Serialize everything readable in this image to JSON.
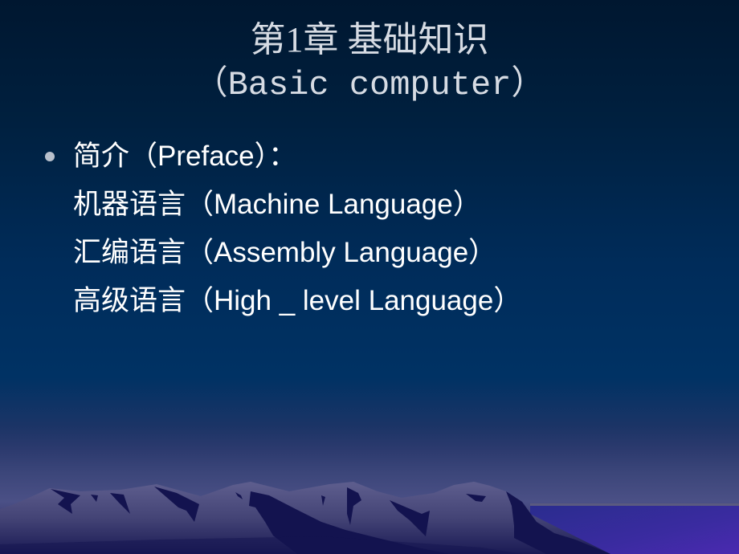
{
  "slide": {
    "title_line1": "第1章 基础知识",
    "title_line2": "（Basic computer）",
    "bullets": [
      {
        "text": "简介（Preface）：",
        "subitems": [
          "机器语言（Machine Language）",
          "汇编语言（Assembly Language）",
          "高级语言（High _ level Language）"
        ]
      }
    ]
  },
  "colors": {
    "background_top": "#001730",
    "background_mid": "#003264",
    "title_text": "#d6dbe3",
    "body_text": "#ffffff",
    "mountain_light": "#5a5a8a",
    "mountain_dark": "#13134f",
    "lake": "#4128a6"
  },
  "decoration": {
    "scene_icon": "mountain-landscape"
  }
}
